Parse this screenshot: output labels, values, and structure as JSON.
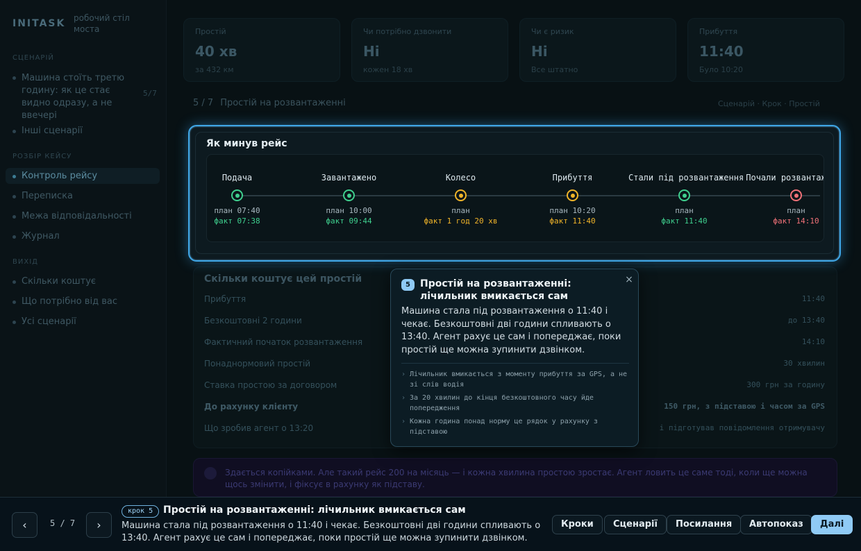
{
  "app": {
    "brand": "INITASK",
    "brand_sub": "робочий стіл моста"
  },
  "sidebar": {
    "section_scenarios": "Сценарій",
    "scenario_active": "Машина стоїть третю годину: як це стає видно одразу, а не ввечері",
    "scenario_count": "5/7",
    "scenario_other": "Інші сценарії",
    "section_process": "Розбір кейсу",
    "items": [
      {
        "label": "Контроль рейсу"
      },
      {
        "label": "Переписка"
      },
      {
        "label": "Межа відповідальності"
      },
      {
        "label": "Журнал"
      }
    ],
    "section_outputs": "Вихід",
    "outputs": [
      {
        "label": "Скільки коштує"
      },
      {
        "label": "Що потрібно від вас"
      },
      {
        "label": "Усі сценарії"
      }
    ]
  },
  "kpis": [
    {
      "label": "Простій",
      "value": "40 хв",
      "sub": "за 432 км"
    },
    {
      "label": "Чи потрібно дзвонити",
      "value": "Ні",
      "sub": "кожен 18 хв"
    },
    {
      "label": "Чи є ризик",
      "value": "Ні",
      "sub": "Все штатно"
    },
    {
      "label": "Прибуття",
      "value": "11:40",
      "sub": "Було 10:20"
    }
  ],
  "breadcrumb": {
    "prefix": "5 / 7",
    "title": "Простій на розвантаженні",
    "right": "Сценарій · Крок · Простій"
  },
  "trip": {
    "title": "Як минув рейс",
    "stages": [
      {
        "name": "Подача",
        "plan": "план 07:40",
        "fact": "факт 07:38",
        "status": "green"
      },
      {
        "name": "Завантажено",
        "plan": "план 10:00",
        "fact": "факт 09:44",
        "status": "green"
      },
      {
        "name": "Колесо",
        "plan": "план",
        "fact": "факт 1 год 20 хв",
        "status": "amber"
      },
      {
        "name": "Прибуття",
        "plan": "план 10:20",
        "fact": "факт 11:40",
        "status": "amber"
      },
      {
        "name": "Стали під розвантаження",
        "plan": "план",
        "fact": "факт 11:40",
        "status": "green"
      },
      {
        "name": "Почали розвантаження",
        "plan": "план",
        "fact": "факт 14:10",
        "status": "red"
      }
    ]
  },
  "cost": {
    "title": "Скільки коштує цей простій",
    "rows": [
      {
        "label": "Прибуття",
        "value": "11:40",
        "bold": false
      },
      {
        "label": "Безкоштовні 2 години",
        "value": "до 13:40",
        "bold": false
      },
      {
        "label": "Фактичний початок розвантаження",
        "value": "14:10",
        "bold": false
      },
      {
        "label": "Понаднормовий простій",
        "value": "30 хвилин",
        "bold": false
      },
      {
        "label": "Ставка простою за договором",
        "value": "300 грн за годину",
        "bold": false
      },
      {
        "label": "До рахунку клієнту",
        "value": "150 грн, з підставою і часом за GPS",
        "bold": true
      },
      {
        "label": "Що зробив агент о 13:20",
        "value": "і підготував повідомлення отримувачу",
        "bold": false
      }
    ],
    "note": "Здається копійками. Але такий рейс 200 на місяць — і кожна хвилина простою зростає. Агент ловить це саме тоді, коли ще можна щось змінити, і фіксує в рахунку як підставу."
  },
  "popover": {
    "number": "5",
    "title": "Простій на розвантаженні: лічильник вмикається сам",
    "body": "Машина стала під розвантаження о 11:40 і чекає. Безкоштовні дві години спливають о 13:40. Агент рахує це сам і попереджає, поки простій ще можна зупинити дзвінком.",
    "close": "×",
    "bullets": [
      "Лічильник вмикається з моменту прибуття за GPS, а не зі слів водія",
      "За 20 хвилин до кінця безкоштовного часу йде попередження",
      "Кожна година понад норму це рядок у рахунку з підставою"
    ]
  },
  "bottom": {
    "prev": "‹",
    "next": "›",
    "counter": "5 / 7",
    "step_badge": "крок 5",
    "title": "Простій на розвантаженні: лічильник вмикається сам",
    "desc": "Машина стала під розвантаження о 11:40 і чекає. Безкоштовні дві години спливають о 13:40. Агент рахує це сам і попереджає, поки простій ще можна зупинити дзвінком.",
    "buttons": {
      "steps": "Кроки",
      "scenarios": "Сценарії",
      "links": "Посилання",
      "autoplay": "Автопоказ",
      "next": "Далі"
    }
  },
  "colors": {
    "accent": "#3fa6e6",
    "green": "#3fcf8e",
    "amber": "#f0b429",
    "red": "#f07178",
    "primary_button": "#8fcaf5"
  }
}
